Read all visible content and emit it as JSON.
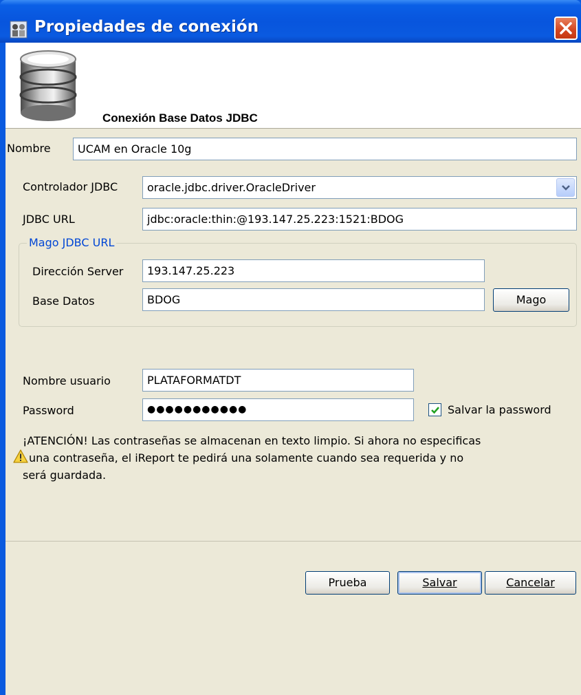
{
  "window": {
    "title": "Propiedades de conexión"
  },
  "header": {
    "title": "Conexión Base Datos JDBC",
    "icon": "database-icon"
  },
  "form": {
    "nombre_label": "Nombre",
    "nombre_value": "UCAM en Oracle 10g",
    "driver_label": "Controlador JDBC",
    "driver_value": "oracle.jdbc.driver.OracleDriver",
    "url_label": "JDBC URL",
    "url_value": "jdbc:oracle:thin:@193.147.25.223:1521:BDOG",
    "wizard": {
      "legend": "Mago JDBC URL",
      "server_label": "Dirección Server",
      "server_value": "193.147.25.223",
      "db_label": "Base Datos",
      "db_value": "BDOG",
      "wizard_button": "Mago"
    },
    "user_label": "Nombre usuario",
    "user_value": "PLATAFORMATDT",
    "password_label": "Password",
    "password_value": "●●●●●●●●●●●",
    "save_password_label": "Salvar la password",
    "save_password_checked": true
  },
  "warning": {
    "icon": "warning-icon",
    "line1": "¡ATENCIÓN! Las contraseñas se almacenan en texto limpio. Si ahora no especificas",
    "line2": "una contraseña, el iReport te pedirá una solamente cuando sea requerida y no",
    "line3": "será guardada."
  },
  "buttons": {
    "test": "Prueba",
    "save": "Salvar",
    "cancel": "Cancelar"
  },
  "colors": {
    "titlebar": "#0855dd",
    "dialog_bg": "#ece9d8",
    "group_legend": "#0046d5"
  }
}
